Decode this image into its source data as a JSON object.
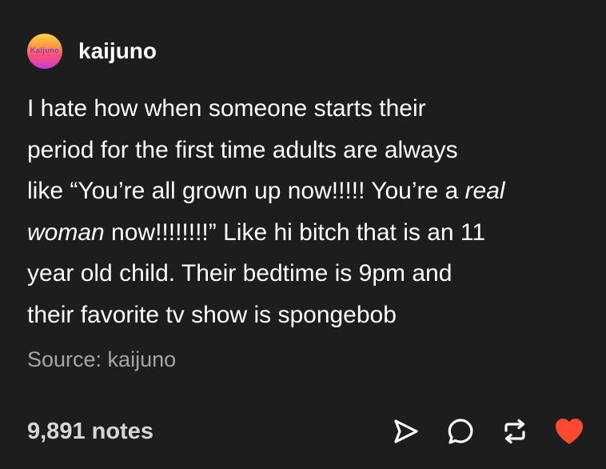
{
  "post": {
    "username": "kaijuno",
    "avatar_text": "Kaijuno",
    "body_lines": [
      "I hate how when someone starts their",
      "period for the first time adults are always",
      [
        "like “You’re all grown up now!!!!! You’re a ",
        "real"
      ],
      [
        "woman",
        " now!!!!!!!!” Like hi bitch that is an 11"
      ],
      "year old child. Their bedtime is 9pm and",
      "their favorite tv show is spongebob"
    ],
    "source": "Source: kaijuno"
  },
  "footer": {
    "notes": "9,891 notes",
    "icons": [
      "share-icon",
      "reply-icon",
      "reblog-icon",
      "like-icon"
    ]
  },
  "colors": {
    "background": "#1d1d1d",
    "like": "#ff4930",
    "muted": "#a6a6a6"
  }
}
